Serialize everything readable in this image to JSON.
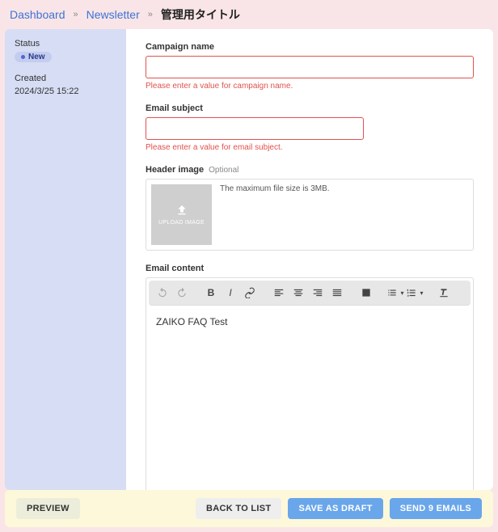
{
  "breadcrumb": {
    "dashboard": "Dashboard",
    "newsletter": "Newsletter",
    "current": "管理用タイトル"
  },
  "sidebar": {
    "status_label": "Status",
    "status_badge": "New",
    "created_label": "Created",
    "created_value": "2024/3/25 15:22"
  },
  "form": {
    "campaign_name": {
      "label": "Campaign name",
      "value": "",
      "error": "Please enter a value for campaign name."
    },
    "email_subject": {
      "label": "Email subject",
      "value": "",
      "error": "Please enter a value for email subject."
    },
    "header_image": {
      "label": "Header image",
      "optional": "Optional",
      "upload_text": "UPLOAD IMAGE",
      "hint": "The maximum file size is 3MB."
    },
    "email_content": {
      "label": "Email content",
      "body": "ZAIKO FAQ Test"
    }
  },
  "footer": {
    "preview": "PREVIEW",
    "back": "BACK TO LIST",
    "save": "SAVE AS DRAFT",
    "send": "SEND 9 EMAILS"
  }
}
